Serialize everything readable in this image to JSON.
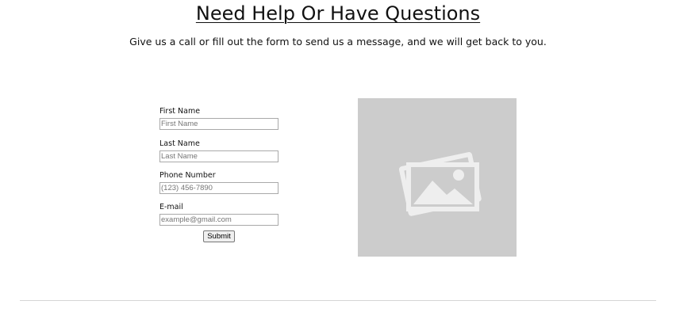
{
  "header": {
    "title": "Need Help Or Have Questions",
    "subtitle": "Give us a call or fill out the form to send us a message, and we will get back to you."
  },
  "form": {
    "fields": [
      {
        "label": "First Name",
        "placeholder": "First Name",
        "value": ""
      },
      {
        "label": "Last Name",
        "placeholder": "Last Name",
        "value": ""
      },
      {
        "label": "Phone Number",
        "placeholder": "(123) 456-7890",
        "value": ""
      },
      {
        "label": "E-mail",
        "placeholder": "example@gmail.com",
        "value": ""
      }
    ],
    "submit_label": "Submit"
  },
  "media": {
    "icon": "image-placeholder-icon",
    "background_color": "#cccccc"
  }
}
